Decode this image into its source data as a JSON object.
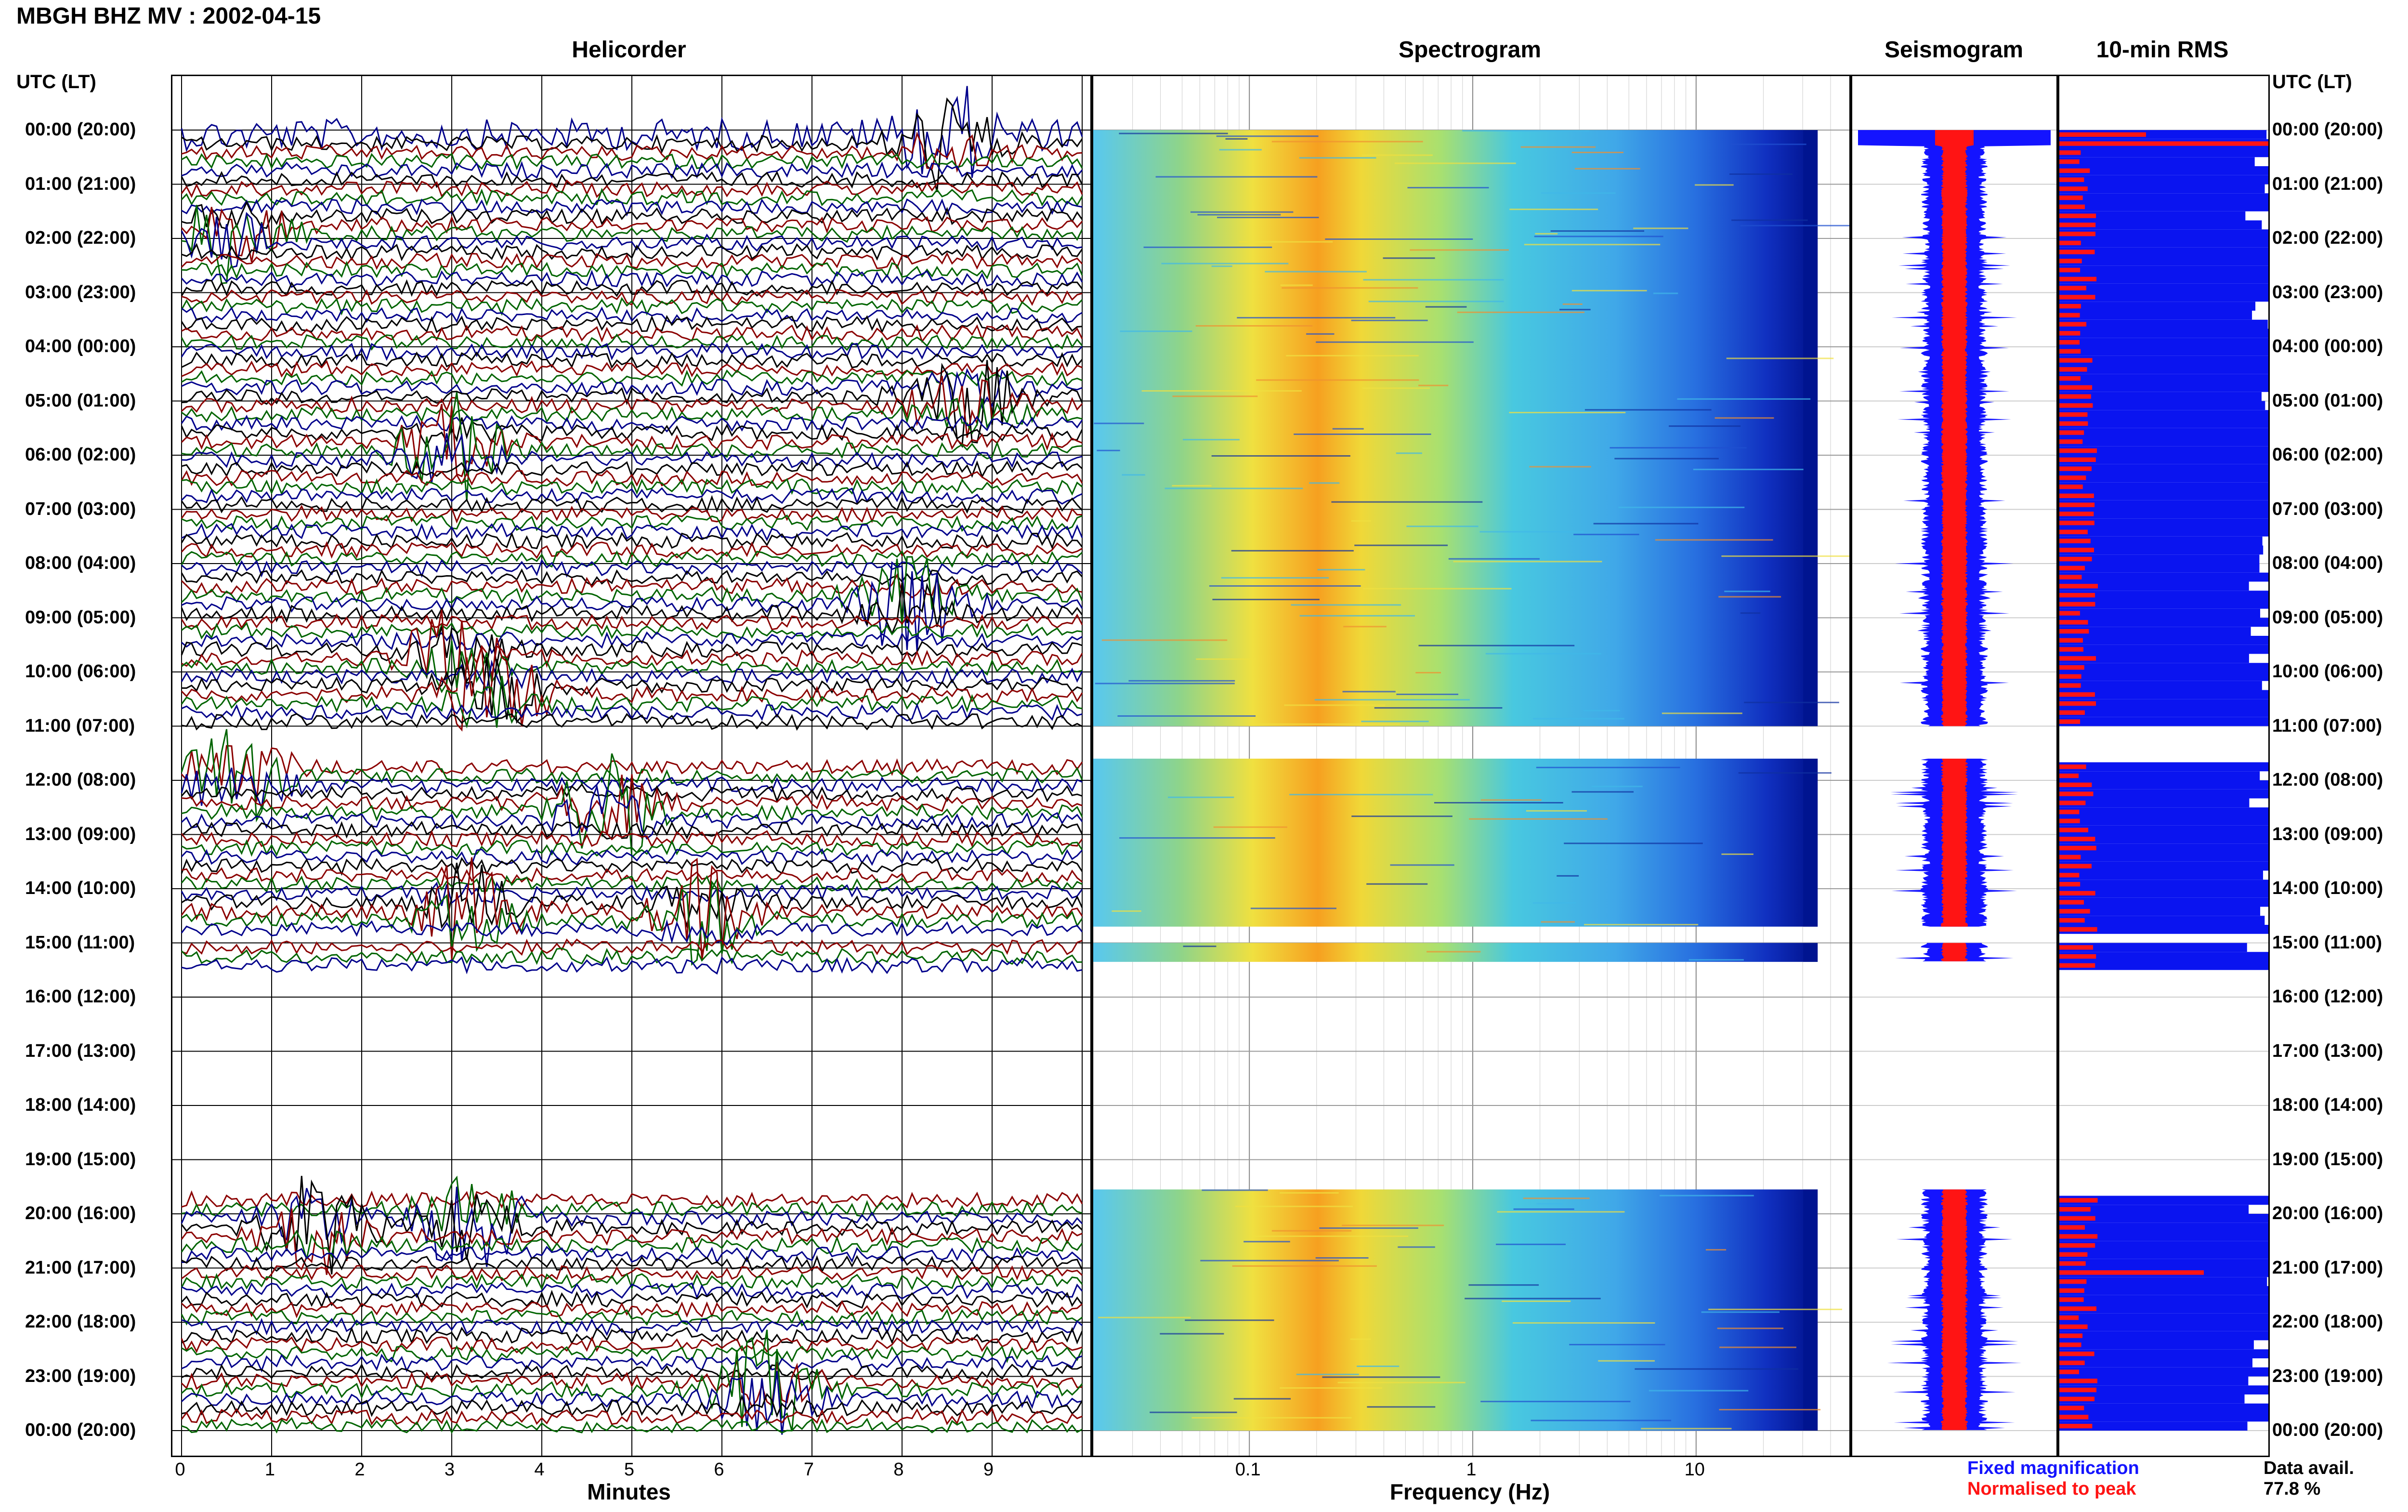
{
  "header": {
    "title": "MBGH BHZ MV : 2002-04-15"
  },
  "panels": {
    "helicorder_title": "Helicorder",
    "spectrogram_title": "Spectrogram",
    "seismogram_title": "Seismogram",
    "rms_title": "10-min RMS"
  },
  "axis": {
    "utc_label_left": "UTC (LT)",
    "utc_label_right": "UTC (LT)",
    "minutes_label": "Minutes",
    "frequency_label": "Frequency (Hz)"
  },
  "legend": {
    "fixed": "Fixed magnification",
    "normalised": "Normalised to peak",
    "fixed_color": "#1414ff",
    "normalised_color": "#ff1414",
    "data_avail_label": "Data avail.",
    "data_avail_value": "77.8 %"
  },
  "chart_data": {
    "type": "heatmap",
    "time_labels": [
      "00:00 (20:00)",
      "01:00 (21:00)",
      "02:00 (22:00)",
      "03:00 (23:00)",
      "04:00 (00:00)",
      "05:00 (01:00)",
      "06:00 (02:00)",
      "07:00 (03:00)",
      "08:00 (04:00)",
      "09:00 (05:00)",
      "10:00 (06:00)",
      "11:00 (07:00)",
      "12:00 (08:00)",
      "13:00 (09:00)",
      "14:00 (10:00)",
      "15:00 (11:00)",
      "16:00 (12:00)",
      "17:00 (13:00)",
      "18:00 (14:00)",
      "19:00 (15:00)",
      "20:00 (16:00)",
      "21:00 (17:00)",
      "22:00 (18:00)",
      "23:00 (19:00)",
      "00:00 (20:00)"
    ],
    "minutes_ticks": [
      "0",
      "1",
      "2",
      "3",
      "4",
      "5",
      "6",
      "7",
      "8",
      "9"
    ],
    "frequency_ticks": [
      "0.1",
      "1",
      "10"
    ],
    "frequency_range": [
      0.02,
      50
    ],
    "trace_colors": [
      "#00008b",
      "#000000",
      "#8b0000",
      "#006400"
    ],
    "data_gaps_hours": [
      [
        11.0,
        11.6
      ],
      [
        14.7,
        15.0
      ],
      [
        15.35,
        19.55
      ]
    ],
    "seismogram_colors": [
      "#1414ff",
      "#ff1414"
    ],
    "events": [
      {
        "hour": 0.1,
        "minute": 8.5
      },
      {
        "hour": 1.8,
        "minute": 0.6
      },
      {
        "hour": 4.9,
        "minute": 8.7
      },
      {
        "hour": 5.8,
        "minute": 3.0
      },
      {
        "hour": 8.65,
        "minute": 8.1
      },
      {
        "hour": 9.6,
        "minute": 3.0
      },
      {
        "hour": 10.3,
        "minute": 3.5
      },
      {
        "hour": 11.8,
        "minute": 0.6
      },
      {
        "hour": 12.5,
        "minute": 4.7
      },
      {
        "hour": 14.3,
        "minute": 3.2
      },
      {
        "hour": 14.4,
        "minute": 5.8
      },
      {
        "hour": 20.0,
        "minute": 3.2
      },
      {
        "hour": 20.2,
        "minute": 1.5
      },
      {
        "hour": 23.2,
        "minute": 6.5
      }
    ]
  }
}
